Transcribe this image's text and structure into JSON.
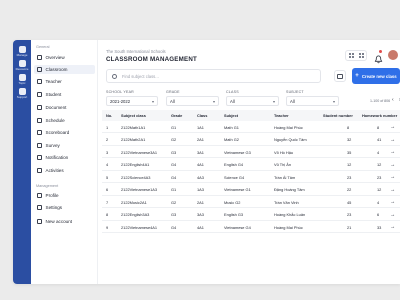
{
  "rail": [
    {
      "label": "Manage",
      "icon": "manage-icon"
    },
    {
      "label": "Resource",
      "icon": "resource-icon"
    },
    {
      "label": "Topic",
      "icon": "topic-icon"
    },
    {
      "label": "Support",
      "icon": "support-icon"
    }
  ],
  "sidebar": {
    "general_title": "General",
    "management_title": "Management",
    "general_items": [
      {
        "label": "Overview",
        "icon": "overview-icon"
      },
      {
        "label": "Classroom",
        "icon": "classroom-icon"
      },
      {
        "label": "Teacher",
        "icon": "teacher-icon"
      },
      {
        "label": "Student",
        "icon": "student-icon"
      },
      {
        "label": "Document",
        "icon": "document-icon"
      },
      {
        "label": "Schedule",
        "icon": "schedule-icon"
      },
      {
        "label": "Scoreboard",
        "icon": "scoreboard-icon"
      },
      {
        "label": "Survey",
        "icon": "survey-icon"
      },
      {
        "label": "Notification",
        "icon": "notification-icon"
      },
      {
        "label": "Activities",
        "icon": "activities-icon"
      }
    ],
    "management_items": [
      {
        "label": "Profile",
        "icon": "profile-icon"
      },
      {
        "label": "Settings",
        "icon": "settings-icon"
      },
      {
        "label": "New account",
        "icon": "new-account-icon"
      }
    ]
  },
  "header": {
    "school": "The South International Schools",
    "title": "CLASSROOM MANAGEMENT"
  },
  "search": {
    "placeholder": "Find subject class..."
  },
  "create_button": "Create new class",
  "filters": [
    {
      "label": "SCHOOL YEAR",
      "value": "2021-2022"
    },
    {
      "label": "GRADE",
      "value": "All"
    },
    {
      "label": "CLASS",
      "value": "All"
    },
    {
      "label": "SUBJECT",
      "value": "All"
    }
  ],
  "paging": "1-100 of 806",
  "table": {
    "headers": [
      "No.",
      "Subject class",
      "Grade",
      "Class",
      "Subject",
      "Teacher",
      "Student number",
      "Homework number"
    ],
    "rows": [
      [
        "1",
        "2122Math1A1",
        "G1",
        "1A1",
        "Math G1",
        "Hoàng Mai Phúc",
        "8",
        "8"
      ],
      [
        "2",
        "2122Math2A1",
        "G2",
        "2A1",
        "Math G2",
        "Nguyễn Quốc Tâm",
        "32",
        "41"
      ],
      [
        "3",
        "2122Vietnamese3A1",
        "G3",
        "3A1",
        "Vietnamese G3",
        "Võ Hồ Hậu",
        "35",
        "4"
      ],
      [
        "4",
        "2122English4A1",
        "G4",
        "4A1",
        "English G4",
        "Vũ Thị Ân",
        "12",
        "12"
      ],
      [
        "5",
        "2122Science4A3",
        "G4",
        "4A3",
        "Science G4",
        "Trần Ái Tâm",
        "23",
        "23"
      ],
      [
        "6",
        "2122Vietnamese1A3",
        "G1",
        "1A3",
        "Vietnamese G1",
        "Đặng Hoàng Tâm",
        "22",
        "12"
      ],
      [
        "7",
        "2122Music2A1",
        "G2",
        "2A1",
        "Music G2",
        "Trần Văn Vinh",
        "45",
        "4"
      ],
      [
        "8",
        "2122English3A3",
        "G3",
        "3A3",
        "English G3",
        "Hoàng Khắc Luân",
        "23",
        "6"
      ],
      [
        "9",
        "2122Vietnamese4A1",
        "G4",
        "4A1",
        "Vietnamese G4",
        "Hoàng Mai Phúc",
        "21",
        "33"
      ]
    ]
  }
}
